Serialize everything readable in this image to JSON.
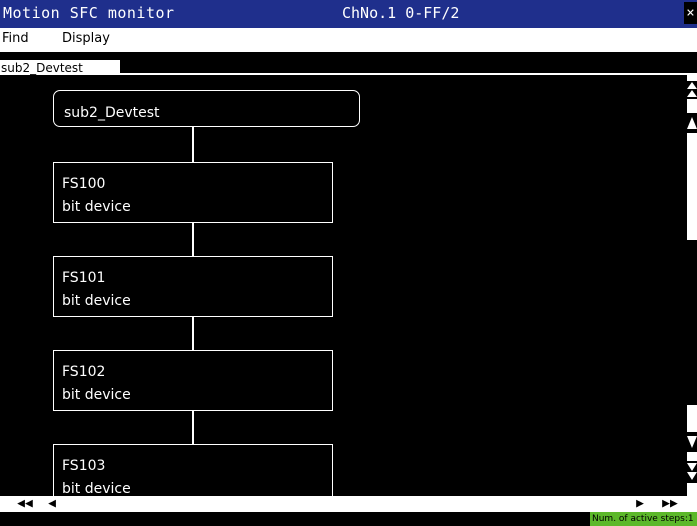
{
  "window": {
    "title": "Motion SFC monitor",
    "channel_info": "ChNo.1 0-FF/2",
    "close_label": "×"
  },
  "menu": {
    "items": [
      "Find",
      "Display"
    ]
  },
  "tab": {
    "label": "sub2_Devtest"
  },
  "sfc": {
    "program_name": "sub2_Devtest",
    "steps": [
      {
        "label": "FS100",
        "description": "bit device"
      },
      {
        "label": "FS101",
        "description": "bit device"
      },
      {
        "label": "FS102",
        "description": "bit device"
      },
      {
        "label": "FS103",
        "description": "bit device"
      }
    ]
  },
  "scrollbar": {
    "first": "◀◀",
    "prev": "◀",
    "next": "▶",
    "last": "▶▶"
  },
  "status": {
    "active_steps_label": "Num. of active steps:1"
  },
  "colors": {
    "title_bar": "#1f2f8c",
    "status_active": "#5cb82a"
  }
}
